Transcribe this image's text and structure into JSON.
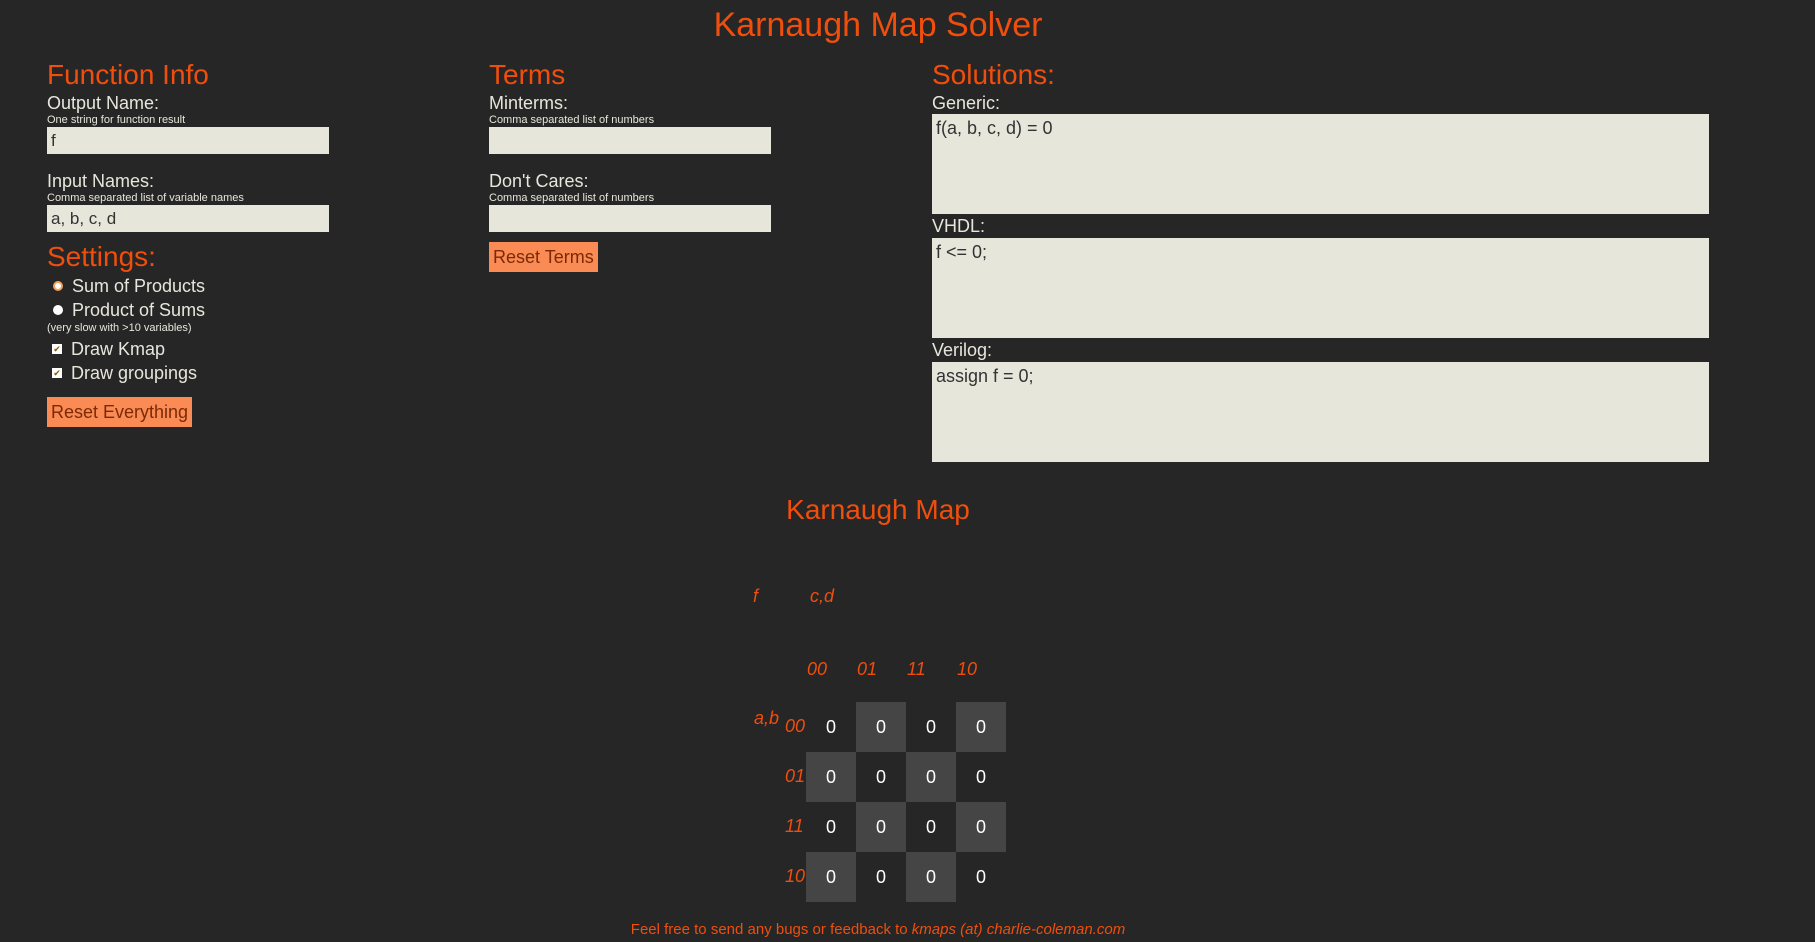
{
  "app": {
    "title": "Karnaugh Map Solver"
  },
  "function_info": {
    "heading": "Function Info",
    "output_name_label": "Output Name:",
    "output_name_hint": "One string for function result",
    "output_name_value": "f",
    "input_names_label": "Input Names:",
    "input_names_hint": "Comma separated list of variable names",
    "input_names_value": "a, b, c, d"
  },
  "settings": {
    "heading": "Settings:",
    "sop_label": "Sum of Products",
    "pos_label": "Product of Sums",
    "pos_note": "(very slow with >10 variables)",
    "draw_kmap_label": "Draw Kmap",
    "draw_groupings_label": "Draw groupings",
    "sop_selected": true,
    "draw_kmap_checked": true,
    "draw_groupings_checked": true,
    "reset_everything_label": "Reset Everything"
  },
  "terms": {
    "heading": "Terms",
    "minterms_label": "Minterms:",
    "minterms_hint": "Comma separated list of numbers",
    "minterms_value": "",
    "dontcares_label": "Don't Cares:",
    "dontcares_hint": "Comma separated list of numbers",
    "dontcares_value": "",
    "reset_terms_label": "Reset Terms"
  },
  "solutions": {
    "heading": "Solutions:",
    "generic_label": "Generic:",
    "generic_value": "f(a, b, c, d) = 0",
    "vhdl_label": "VHDL:",
    "vhdl_value": "f <= 0;",
    "verilog_label": "Verilog:",
    "verilog_value": "assign f = 0;"
  },
  "kmap": {
    "title": "Karnaugh Map",
    "function_name": "f",
    "col_vars": "c,d",
    "row_vars": "a,b",
    "col_headers": [
      "00",
      "01",
      "11",
      "10"
    ],
    "row_headers": [
      "00",
      "01",
      "11",
      "10"
    ],
    "cells": [
      [
        "0",
        "0",
        "0",
        "0"
      ],
      [
        "0",
        "0",
        "0",
        "0"
      ],
      [
        "0",
        "0",
        "0",
        "0"
      ],
      [
        "0",
        "0",
        "0",
        "0"
      ]
    ]
  },
  "footer": {
    "text": "Feel free to send any bugs or feedback to",
    "email": "kmaps (at) charlie-coleman.com"
  },
  "colors": {
    "background": "#262626",
    "accent": "#f04e0c",
    "button": "#fb8b54",
    "field": "#e6e6db",
    "cell_dark": "#454545"
  }
}
